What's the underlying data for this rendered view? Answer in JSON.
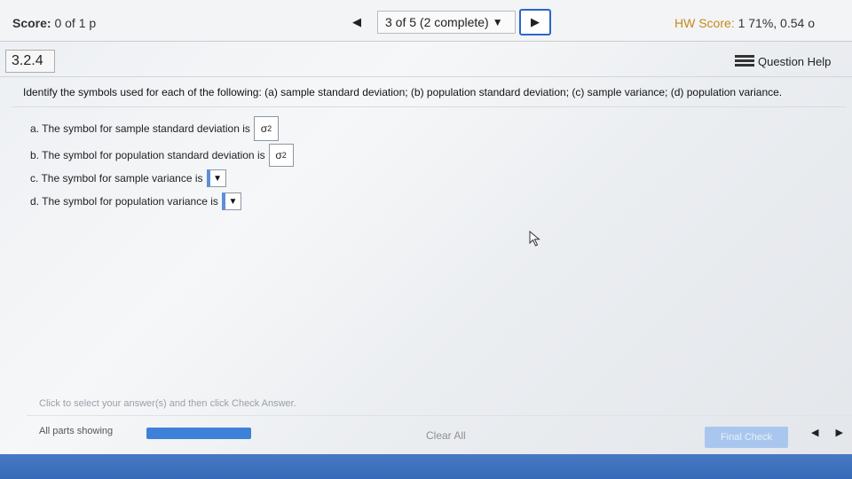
{
  "header": {
    "score_label": "Score:",
    "score_value": "0 of 1 p",
    "prev_arrow": "◀",
    "progress": "3 of 5 (2 complete)",
    "progress_caret": "▼",
    "next_arrow": "▶",
    "hw_label": "HW Score:",
    "hw_value": "1 71%, 0.54 o"
  },
  "question": {
    "number": "3.2.4",
    "help_label": "Question Help",
    "prompt": "Identify the symbols used for each of the following: (a) sample standard deviation; (b) population standard deviation; (c) sample variance; (d) population variance.",
    "items": [
      {
        "text": "a. The symbol for sample standard deviation is",
        "answer": "σ",
        "answer_sup": "2"
      },
      {
        "text": "b. The symbol for population standard deviation is",
        "answer": "σ",
        "answer_sup": "2"
      },
      {
        "text": "c. The symbol for sample variance is",
        "dropdown": "▼"
      },
      {
        "text": "d. The symbol for population variance is",
        "dropdown": "▼"
      }
    ]
  },
  "footer": {
    "hint": "Click to select your answer(s) and then click Check Answer.",
    "parts_label": "All parts showing",
    "clear_label": "Clear All",
    "check_label": "Final Check",
    "prev_arrow": "◀",
    "next_arrow": "▶"
  },
  "colors": {
    "accent": "#2a66c9",
    "progress_fill": "#3d82d8",
    "footer_bar": "#356ab8"
  }
}
